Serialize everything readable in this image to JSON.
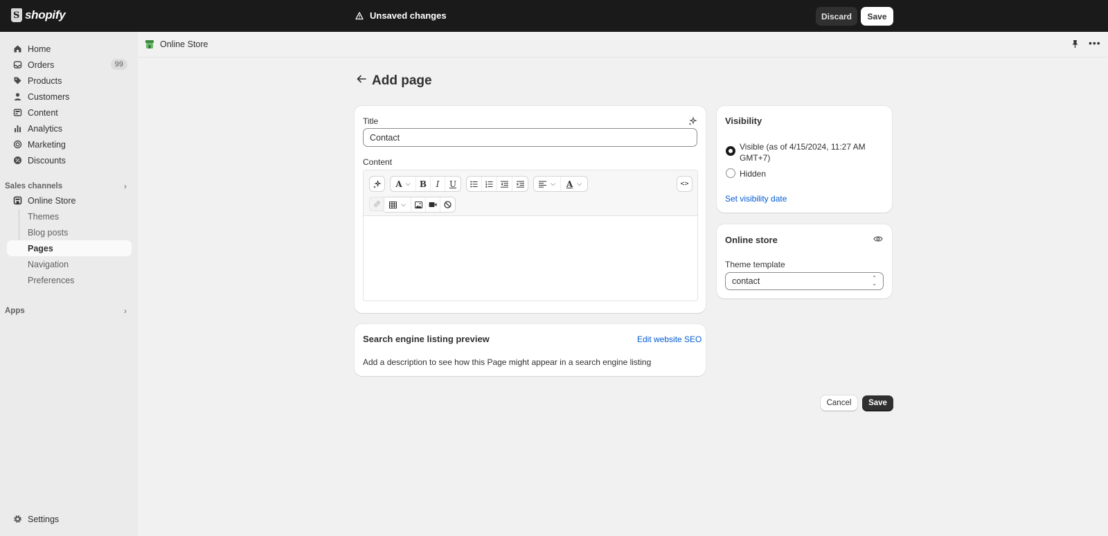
{
  "topbar": {
    "brand": "shopify",
    "status": "Unsaved changes",
    "discard_label": "Discard",
    "save_label": "Save"
  },
  "sidebar": {
    "items": [
      {
        "label": "Home",
        "icon": "home-icon"
      },
      {
        "label": "Orders",
        "icon": "inbox-icon",
        "badge": "99"
      },
      {
        "label": "Products",
        "icon": "tag-icon"
      },
      {
        "label": "Customers",
        "icon": "person-icon"
      },
      {
        "label": "Content",
        "icon": "image-icon"
      },
      {
        "label": "Analytics",
        "icon": "bar-chart-icon"
      },
      {
        "label": "Marketing",
        "icon": "target-icon"
      },
      {
        "label": "Discounts",
        "icon": "discount-icon"
      }
    ],
    "sales_channels_label": "Sales channels",
    "online_store_label": "Online Store",
    "sub_items": [
      "Themes",
      "Blog posts",
      "Pages",
      "Navigation",
      "Preferences"
    ],
    "active_sub_item": "Pages",
    "apps_label": "Apps",
    "settings_label": "Settings"
  },
  "breadcrumb": {
    "label": "Online Store"
  },
  "page": {
    "title": "Add page"
  },
  "content_card": {
    "title_label": "Title",
    "title_value": "Contact",
    "content_label": "Content"
  },
  "seo_card": {
    "title": "Search engine listing preview",
    "edit_link": "Edit website SEO",
    "description": "Add a description to see how this Page might appear in a search engine listing"
  },
  "visibility_card": {
    "title": "Visibility",
    "visible_label": "Visible (as of 4/15/2024, 11:27 AM GMT+7)",
    "visible_line1": "Visible (as of 4/15/2024, 11:27 AM",
    "visible_line2": "GMT+7)",
    "hidden_label": "Hidden",
    "selected": "Visible",
    "set_date_link": "Set visibility date"
  },
  "online_store_card": {
    "title": "Online store",
    "template_label": "Theme template",
    "template_value": "contact"
  },
  "actions": {
    "cancel_label": "Cancel",
    "save_label": "Save"
  },
  "colors": {
    "topbar_bg": "#1a1a1a",
    "link": "#005bd3",
    "primary_button": "#303030",
    "page_bg": "#f1f1f1"
  }
}
